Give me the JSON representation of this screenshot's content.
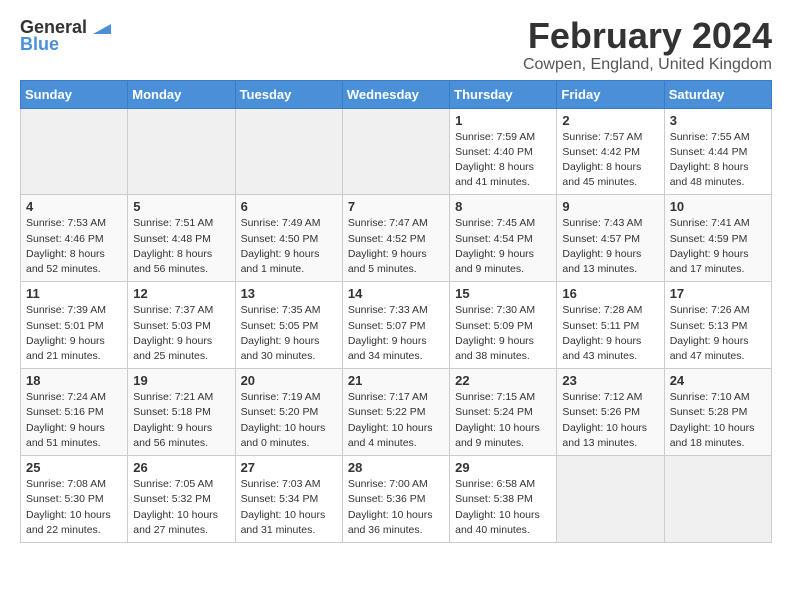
{
  "logo": {
    "text_general": "General",
    "text_blue": "Blue"
  },
  "title": "February 2024",
  "subtitle": "Cowpen, England, United Kingdom",
  "days_of_week": [
    "Sunday",
    "Monday",
    "Tuesday",
    "Wednesday",
    "Thursday",
    "Friday",
    "Saturday"
  ],
  "weeks": [
    [
      {
        "day": "",
        "info": ""
      },
      {
        "day": "",
        "info": ""
      },
      {
        "day": "",
        "info": ""
      },
      {
        "day": "",
        "info": ""
      },
      {
        "day": "1",
        "info": "Sunrise: 7:59 AM\nSunset: 4:40 PM\nDaylight: 8 hours\nand 41 minutes."
      },
      {
        "day": "2",
        "info": "Sunrise: 7:57 AM\nSunset: 4:42 PM\nDaylight: 8 hours\nand 45 minutes."
      },
      {
        "day": "3",
        "info": "Sunrise: 7:55 AM\nSunset: 4:44 PM\nDaylight: 8 hours\nand 48 minutes."
      }
    ],
    [
      {
        "day": "4",
        "info": "Sunrise: 7:53 AM\nSunset: 4:46 PM\nDaylight: 8 hours\nand 52 minutes."
      },
      {
        "day": "5",
        "info": "Sunrise: 7:51 AM\nSunset: 4:48 PM\nDaylight: 8 hours\nand 56 minutes."
      },
      {
        "day": "6",
        "info": "Sunrise: 7:49 AM\nSunset: 4:50 PM\nDaylight: 9 hours\nand 1 minute."
      },
      {
        "day": "7",
        "info": "Sunrise: 7:47 AM\nSunset: 4:52 PM\nDaylight: 9 hours\nand 5 minutes."
      },
      {
        "day": "8",
        "info": "Sunrise: 7:45 AM\nSunset: 4:54 PM\nDaylight: 9 hours\nand 9 minutes."
      },
      {
        "day": "9",
        "info": "Sunrise: 7:43 AM\nSunset: 4:57 PM\nDaylight: 9 hours\nand 13 minutes."
      },
      {
        "day": "10",
        "info": "Sunrise: 7:41 AM\nSunset: 4:59 PM\nDaylight: 9 hours\nand 17 minutes."
      }
    ],
    [
      {
        "day": "11",
        "info": "Sunrise: 7:39 AM\nSunset: 5:01 PM\nDaylight: 9 hours\nand 21 minutes."
      },
      {
        "day": "12",
        "info": "Sunrise: 7:37 AM\nSunset: 5:03 PM\nDaylight: 9 hours\nand 25 minutes."
      },
      {
        "day": "13",
        "info": "Sunrise: 7:35 AM\nSunset: 5:05 PM\nDaylight: 9 hours\nand 30 minutes."
      },
      {
        "day": "14",
        "info": "Sunrise: 7:33 AM\nSunset: 5:07 PM\nDaylight: 9 hours\nand 34 minutes."
      },
      {
        "day": "15",
        "info": "Sunrise: 7:30 AM\nSunset: 5:09 PM\nDaylight: 9 hours\nand 38 minutes."
      },
      {
        "day": "16",
        "info": "Sunrise: 7:28 AM\nSunset: 5:11 PM\nDaylight: 9 hours\nand 43 minutes."
      },
      {
        "day": "17",
        "info": "Sunrise: 7:26 AM\nSunset: 5:13 PM\nDaylight: 9 hours\nand 47 minutes."
      }
    ],
    [
      {
        "day": "18",
        "info": "Sunrise: 7:24 AM\nSunset: 5:16 PM\nDaylight: 9 hours\nand 51 minutes."
      },
      {
        "day": "19",
        "info": "Sunrise: 7:21 AM\nSunset: 5:18 PM\nDaylight: 9 hours\nand 56 minutes."
      },
      {
        "day": "20",
        "info": "Sunrise: 7:19 AM\nSunset: 5:20 PM\nDaylight: 10 hours\nand 0 minutes."
      },
      {
        "day": "21",
        "info": "Sunrise: 7:17 AM\nSunset: 5:22 PM\nDaylight: 10 hours\nand 4 minutes."
      },
      {
        "day": "22",
        "info": "Sunrise: 7:15 AM\nSunset: 5:24 PM\nDaylight: 10 hours\nand 9 minutes."
      },
      {
        "day": "23",
        "info": "Sunrise: 7:12 AM\nSunset: 5:26 PM\nDaylight: 10 hours\nand 13 minutes."
      },
      {
        "day": "24",
        "info": "Sunrise: 7:10 AM\nSunset: 5:28 PM\nDaylight: 10 hours\nand 18 minutes."
      }
    ],
    [
      {
        "day": "25",
        "info": "Sunrise: 7:08 AM\nSunset: 5:30 PM\nDaylight: 10 hours\nand 22 minutes."
      },
      {
        "day": "26",
        "info": "Sunrise: 7:05 AM\nSunset: 5:32 PM\nDaylight: 10 hours\nand 27 minutes."
      },
      {
        "day": "27",
        "info": "Sunrise: 7:03 AM\nSunset: 5:34 PM\nDaylight: 10 hours\nand 31 minutes."
      },
      {
        "day": "28",
        "info": "Sunrise: 7:00 AM\nSunset: 5:36 PM\nDaylight: 10 hours\nand 36 minutes."
      },
      {
        "day": "29",
        "info": "Sunrise: 6:58 AM\nSunset: 5:38 PM\nDaylight: 10 hours\nand 40 minutes."
      },
      {
        "day": "",
        "info": ""
      },
      {
        "day": "",
        "info": ""
      }
    ]
  ]
}
